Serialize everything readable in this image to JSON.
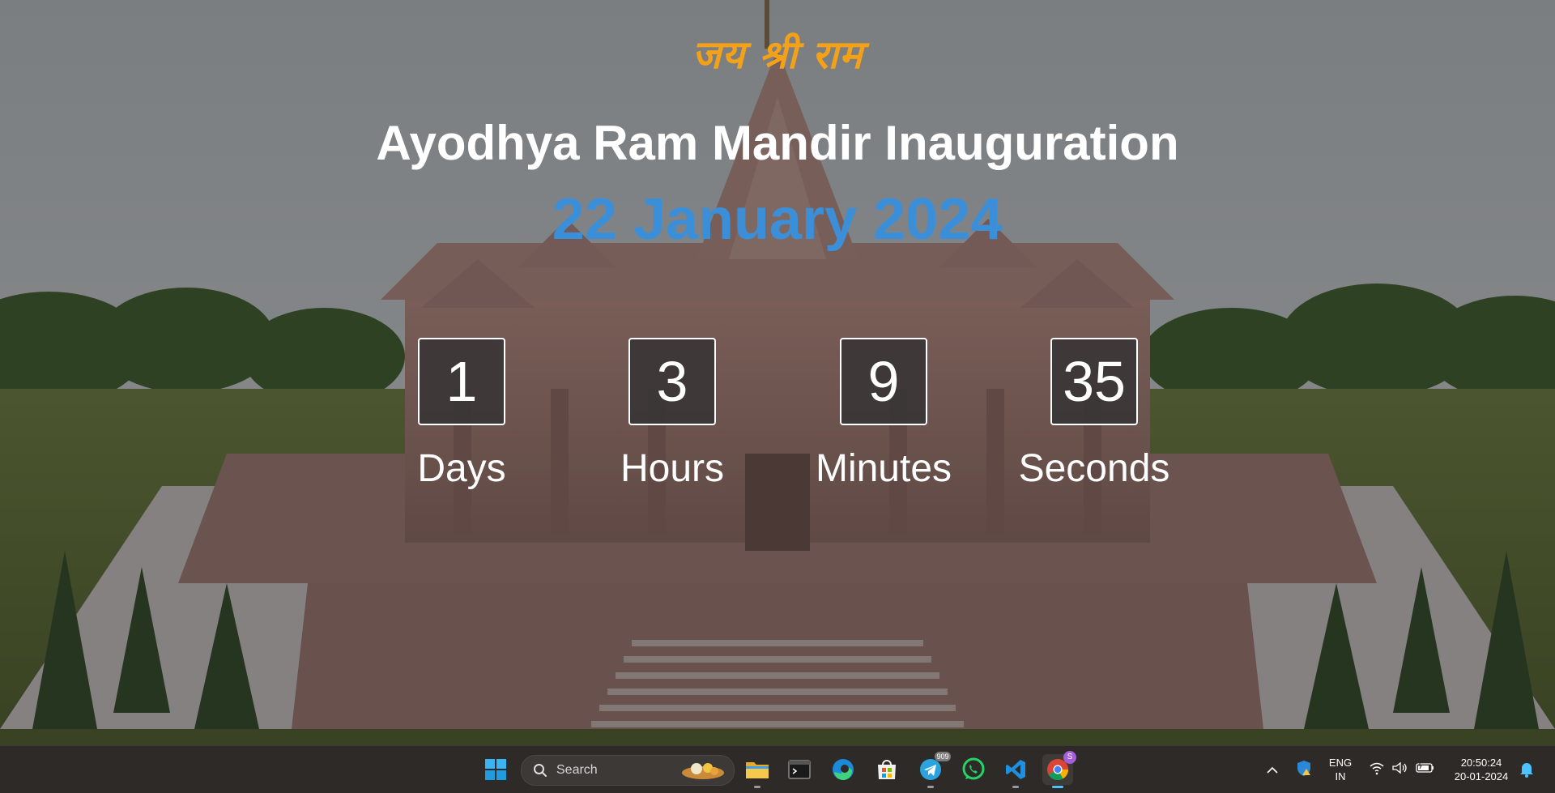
{
  "page": {
    "heading_hindi": "जय श्री राम",
    "title": "Ayodhya Ram Mandir Inauguration",
    "date": "22 January 2024"
  },
  "countdown": [
    {
      "value": "1",
      "label": "Days"
    },
    {
      "value": "3",
      "label": "Hours"
    },
    {
      "value": "9",
      "label": "Minutes"
    },
    {
      "value": "35",
      "label": "Seconds"
    }
  ],
  "taskbar": {
    "search_placeholder": "Search",
    "icons": [
      "windows-start-icon",
      "file-explorer-icon",
      "terminal-icon",
      "edge-icon",
      "microsoft-store-icon",
      "telegram-icon",
      "whatsapp-icon",
      "vscode-icon",
      "chrome-icon"
    ],
    "telegram_badge": "909",
    "chrome_badge": "S",
    "language_top": "ENG",
    "language_bottom": "IN",
    "time": "20:50:24",
    "date": "20-01-2024"
  },
  "colors": {
    "heading_hindi": "#f4a11a",
    "title": "#ffffff",
    "date": "#3b8fd9",
    "taskbar": "#2d2a27"
  }
}
